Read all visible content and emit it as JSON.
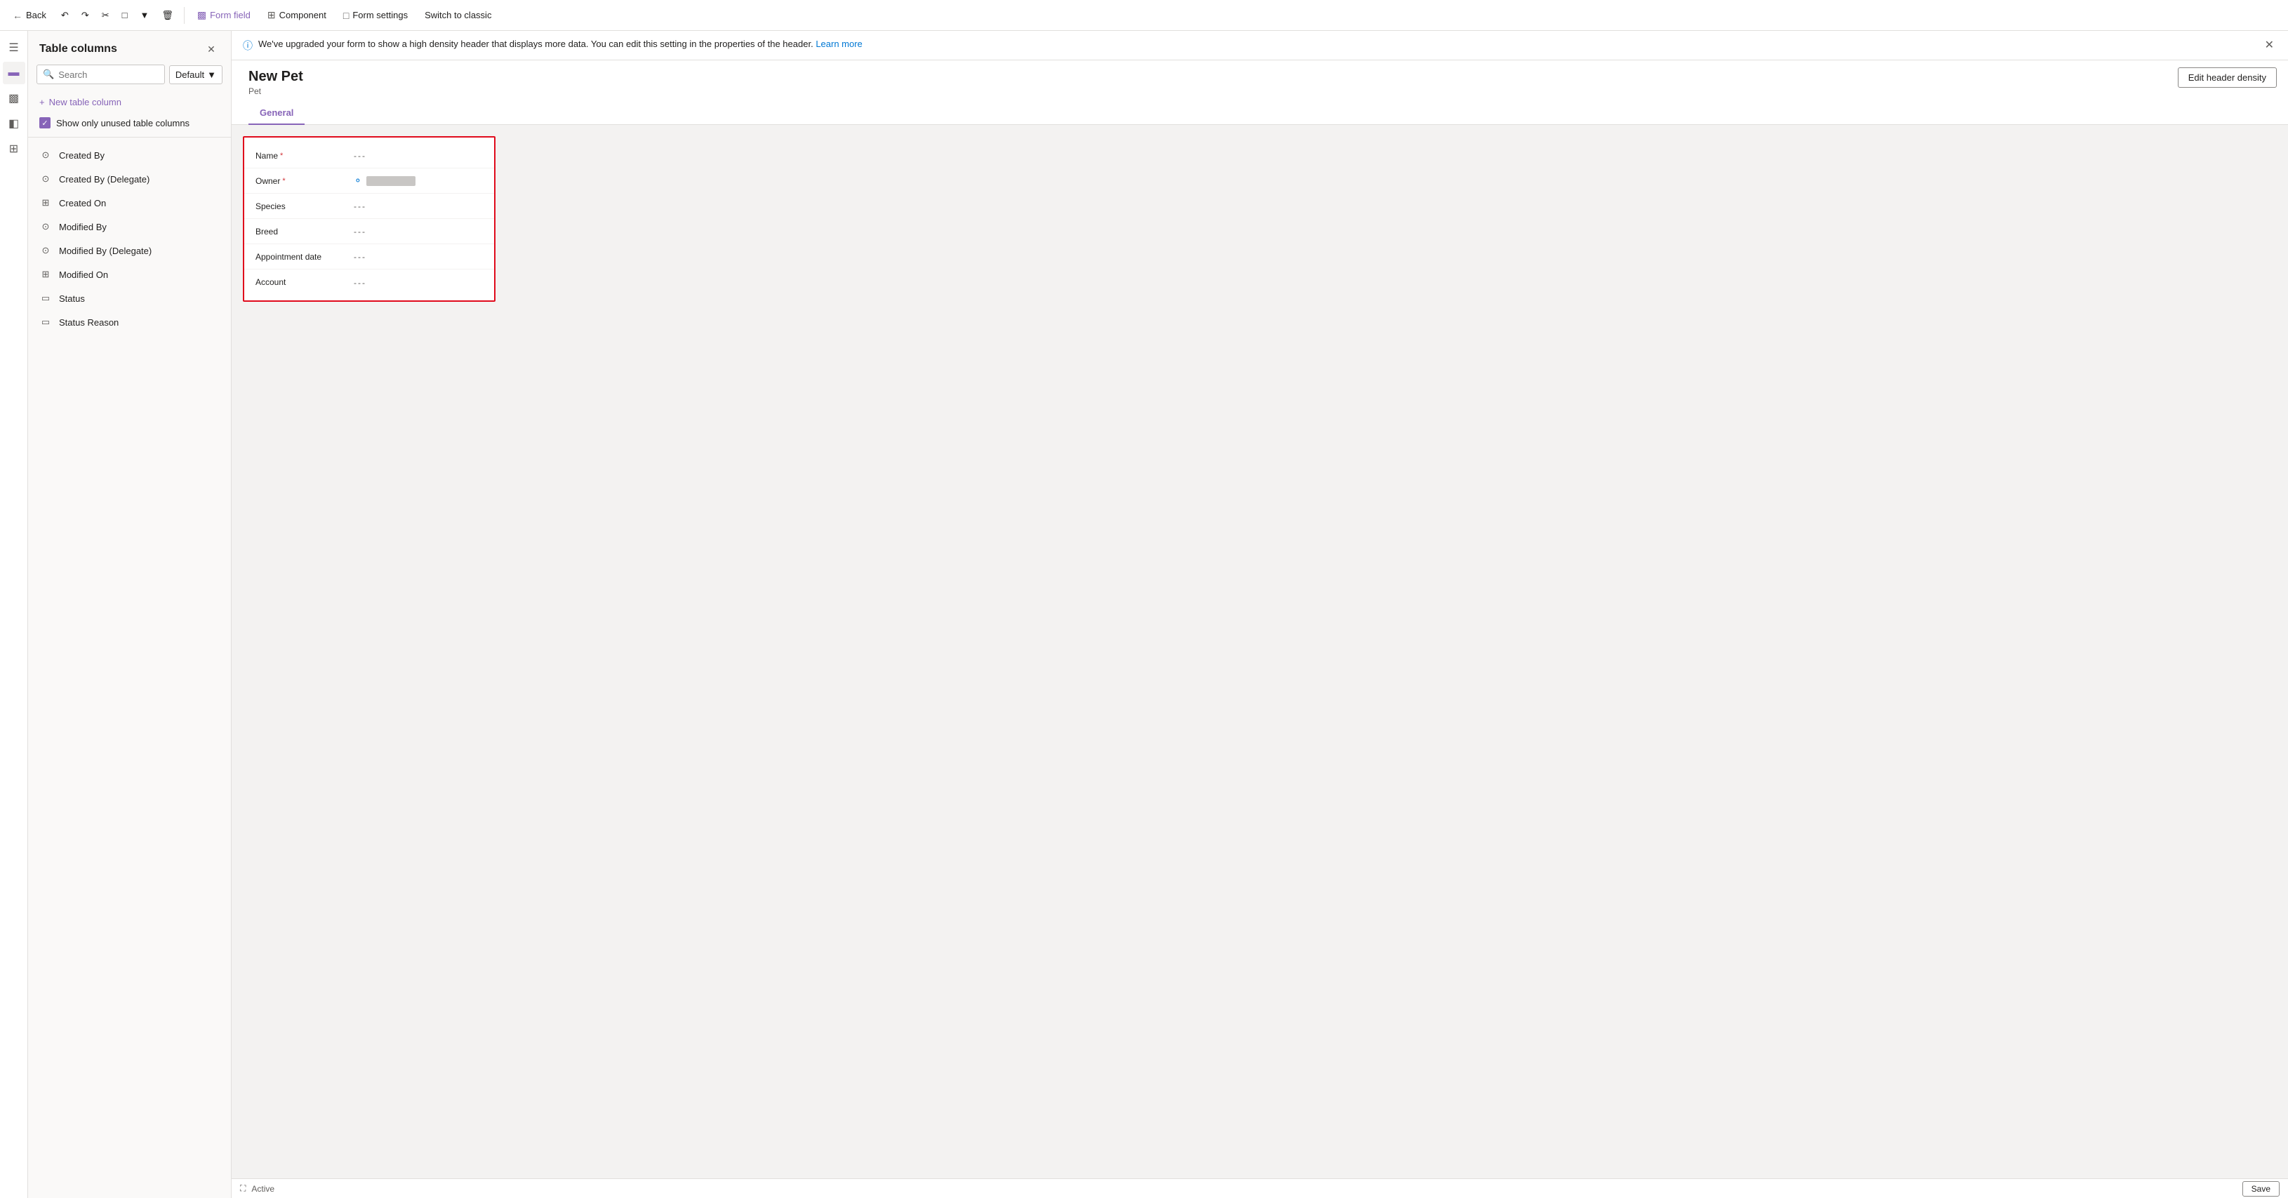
{
  "toolbar": {
    "back_label": "Back",
    "undo_icon": "↩",
    "redo_icon": "↪",
    "cut_icon": "✂",
    "copy_icon": "⊡",
    "more_icon": "▾",
    "delete_icon": "🗑",
    "form_field_label": "Form field",
    "component_label": "Component",
    "form_settings_label": "Form settings",
    "switch_classic_label": "Switch to classic"
  },
  "side_panel": {
    "title": "Table columns",
    "search_placeholder": "Search",
    "default_label": "Default",
    "new_column_label": "New table column",
    "show_unused_label": "Show only unused table columns",
    "columns": [
      {
        "name": "Created By",
        "icon_type": "person"
      },
      {
        "name": "Created By (Delegate)",
        "icon_type": "person"
      },
      {
        "name": "Created On",
        "icon_type": "grid"
      },
      {
        "name": "Modified By",
        "icon_type": "person"
      },
      {
        "name": "Modified By (Delegate)",
        "icon_type": "person"
      },
      {
        "name": "Modified On",
        "icon_type": "grid"
      },
      {
        "name": "Status",
        "icon_type": "box"
      },
      {
        "name": "Status Reason",
        "icon_type": "box"
      }
    ]
  },
  "info_banner": {
    "text": "We've upgraded your form to show a high density header that displays more data. You can edit this setting in the properties of the header.",
    "link_label": "Learn more",
    "edit_header_label": "Edit header density"
  },
  "form": {
    "title": "New Pet",
    "subtitle": "Pet",
    "tab": "General",
    "fields": [
      {
        "label": "Name",
        "required": true,
        "value": "---",
        "type": "text"
      },
      {
        "label": "Owner",
        "required": true,
        "value": "",
        "type": "owner"
      },
      {
        "label": "Species",
        "required": false,
        "value": "---",
        "type": "text"
      },
      {
        "label": "Breed",
        "required": false,
        "value": "---",
        "type": "text"
      },
      {
        "label": "Appointment date",
        "required": false,
        "value": "---",
        "type": "text"
      },
      {
        "label": "Account",
        "required": false,
        "value": "---",
        "type": "text"
      }
    ]
  },
  "status_bar": {
    "status": "Active",
    "save_label": "Save"
  },
  "icons": {
    "person": "⊙",
    "grid": "⊞",
    "box": "▭",
    "search": "🔍",
    "info": "ℹ",
    "form_field": "▤",
    "component": "⊞",
    "settings": "⊡"
  }
}
